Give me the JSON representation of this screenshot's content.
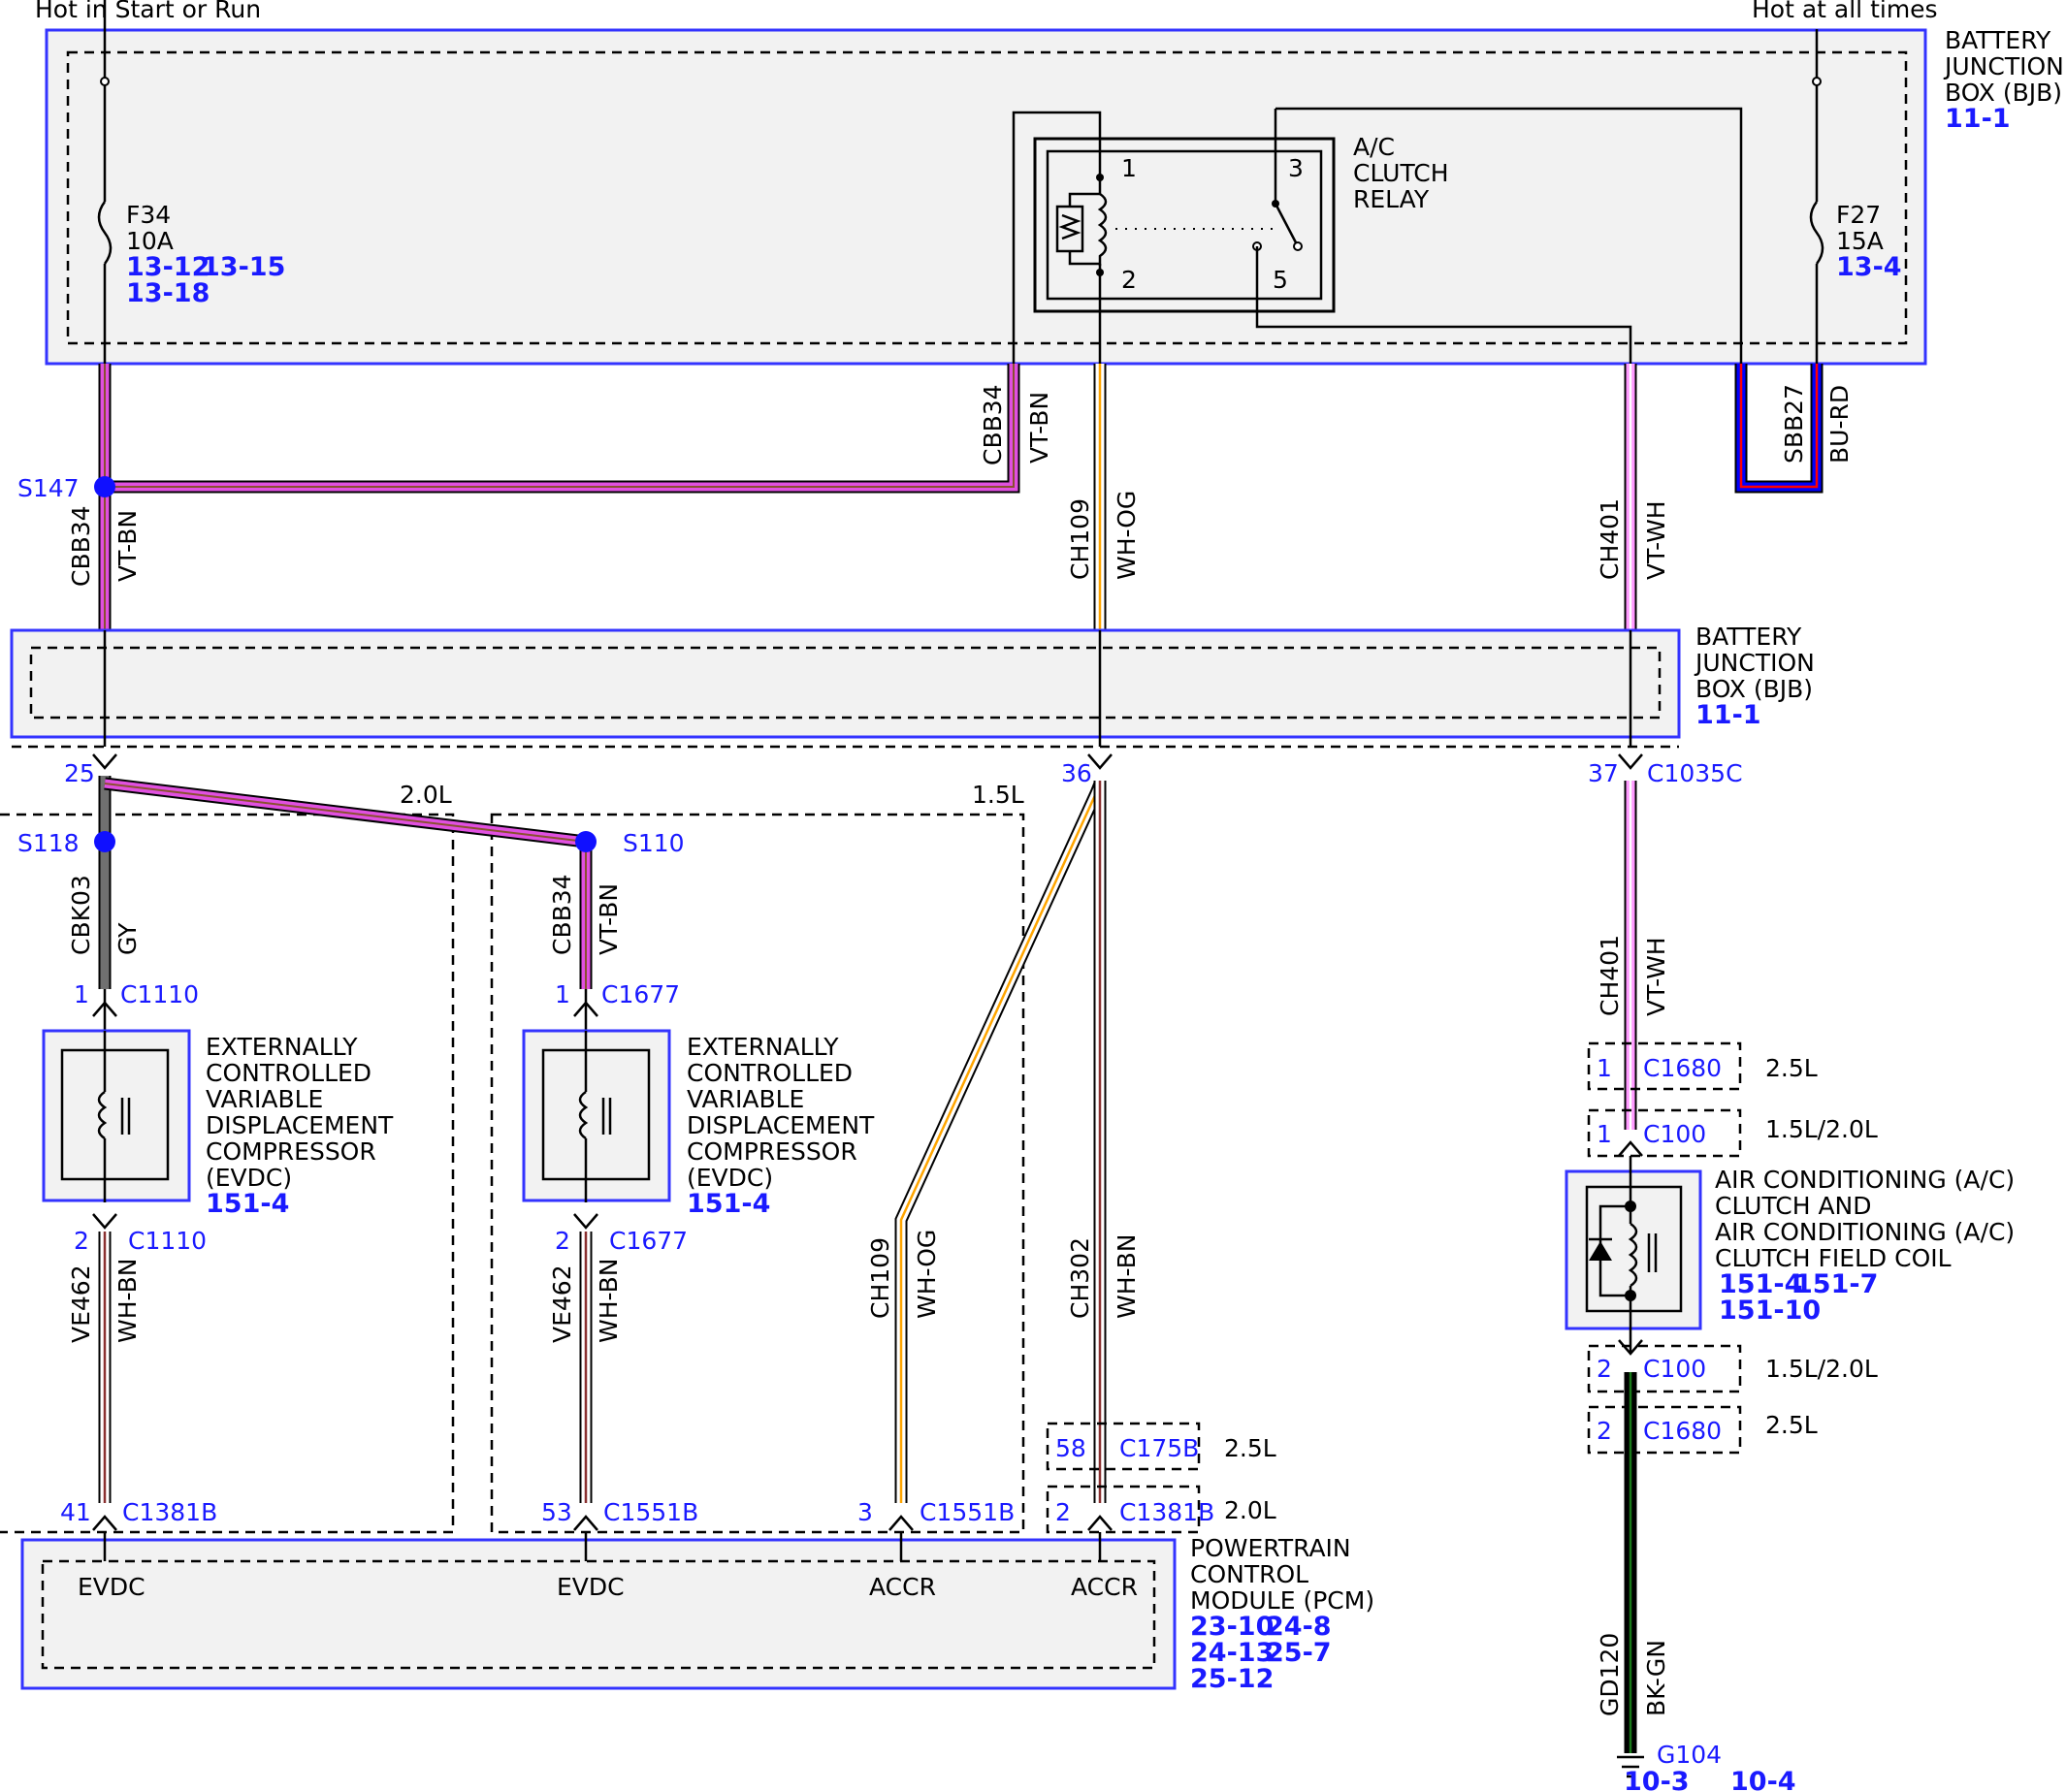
{
  "top_labels": {
    "hot_run": "Hot in Start or Run",
    "hot_all": "Hot at all times"
  },
  "bjb_top": {
    "l1": "BATTERY",
    "l2": "JUNCTION",
    "l3": "BOX (BJB)",
    "ref": "11-1"
  },
  "bjb_mid": {
    "l1": "BATTERY",
    "l2": "JUNCTION",
    "l3": "BOX (BJB)",
    "ref": "11-1"
  },
  "f34": {
    "name": "F34",
    "rating": "10A",
    "ref1": "13-12",
    "ref2": "13-15",
    "ref3": "13-18"
  },
  "f27": {
    "name": "F27",
    "rating": "15A",
    "ref": "13-4"
  },
  "relay": {
    "l1": "A/C",
    "l2": "CLUTCH",
    "l3": "RELAY",
    "p1": "1",
    "p2": "2",
    "p3": "3",
    "p5": "5"
  },
  "wires": {
    "cbb34": "CBB34",
    "vtbn": "VT-BN",
    "ch109": "CH109",
    "whog": "WH-OG",
    "ch401": "CH401",
    "vtwh": "VT-WH",
    "sbb27": "SBB27",
    "burd": "BU-RD",
    "cbk03": "CBK03",
    "gy": "GY",
    "ve462": "VE462",
    "whbn": "WH-BN",
    "ch302": "CH302",
    "gd120": "GD120",
    "bkgn": "BK-GN"
  },
  "splices": {
    "s147": "S147",
    "s118": "S118",
    "s110": "S110"
  },
  "pins": {
    "p25": "25",
    "p36": "36",
    "p37": "37",
    "c1035c": "C1035C",
    "one": "1",
    "two": "2",
    "c1110": "C1110",
    "c1677": "C1677",
    "c1680": "C1680",
    "c100": "C100",
    "p41": "41",
    "c1381b": "C1381B",
    "p53": "53",
    "c1551b": "C1551B",
    "p3": "3",
    "p58": "58",
    "c175b": "C175B"
  },
  "variants": {
    "v20": "2.0L",
    "v15": "1.5L",
    "v25": "2.5L",
    "v1520": "1.5L/2.0L"
  },
  "evdc": {
    "l1": "EXTERNALLY",
    "l2": "CONTROLLED",
    "l3": "VARIABLE",
    "l4": "DISPLACEMENT",
    "l5": "COMPRESSOR",
    "l6": "(EVDC)",
    "ref": "151-4"
  },
  "ac_coil": {
    "l1": "AIR CONDITIONING (A/C)",
    "l2": "CLUTCH AND",
    "l3": "AIR CONDITIONING (A/C)",
    "l4": "CLUTCH FIELD COIL",
    "ref1": "151-4",
    "ref2": "151-7",
    "ref3": "151-10"
  },
  "pcm": {
    "l1": "POWERTRAIN",
    "l2": "CONTROL",
    "l3": "MODULE (PCM)",
    "ref1": "23-10",
    "ref2": "24-8",
    "ref3": "24-13",
    "ref4": "25-7",
    "ref5": "25-12",
    "pin_evdc": "EVDC",
    "pin_accr": "ACCR"
  },
  "ground": {
    "name": "G104",
    "ref1": "10-3",
    "ref2": "10-4"
  },
  "colors": {
    "vt": "#e050e0",
    "pink": "#ff99ff",
    "bn": "#b07040",
    "wh": "#ffffff",
    "og": "#ffa500",
    "gy": "#707070",
    "bu": "#0000ff",
    "rd": "#ff0000",
    "bk": "#000000",
    "gn": "#1a7a1a",
    "blue": "#1a1aff"
  }
}
